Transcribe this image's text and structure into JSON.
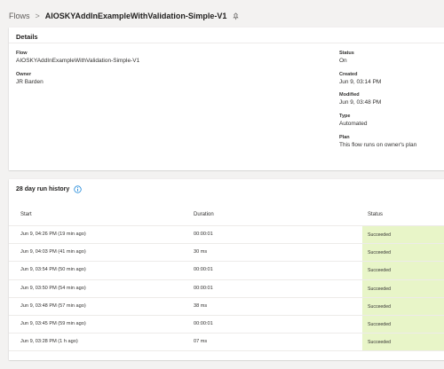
{
  "breadcrumb": {
    "root": "Flows",
    "separator": ">",
    "current": "AIOSKYAddInExampleWithValidation-Simple-V1",
    "pin_icon": "pin-icon"
  },
  "details": {
    "title": "Details",
    "flow_label": "Flow",
    "flow_value": "AIOSKYAddInExampleWithValidation-Simple-V1",
    "owner_label": "Owner",
    "owner_value": "JR Barden",
    "status_label": "Status",
    "status_value": "On",
    "created_label": "Created",
    "created_value": "Jun 9, 03:14 PM",
    "modified_label": "Modified",
    "modified_value": "Jun 9, 03:48 PM",
    "type_label": "Type",
    "type_value": "Automated",
    "plan_label": "Plan",
    "plan_value": "This flow runs on owner's plan"
  },
  "runs": {
    "title": "28 day run history",
    "info_icon": "info-icon",
    "columns": {
      "start": "Start",
      "duration": "Duration",
      "status": "Status"
    },
    "status_color": "#e8f5c8",
    "rows": [
      {
        "start": "Jun 9, 04:26 PM (19 min ago)",
        "duration": "00:00:01",
        "status": "Succeeded"
      },
      {
        "start": "Jun 9, 04:03 PM (41 min ago)",
        "duration": "30 ms",
        "status": "Succeeded"
      },
      {
        "start": "Jun 9, 03:54 PM (50 min ago)",
        "duration": "00:00:01",
        "status": "Succeeded"
      },
      {
        "start": "Jun 9, 03:50 PM (54 min ago)",
        "duration": "00:00:01",
        "status": "Succeeded"
      },
      {
        "start": "Jun 9, 03:48 PM (57 min ago)",
        "duration": "38 ms",
        "status": "Succeeded"
      },
      {
        "start": "Jun 9, 03:45 PM (59 min ago)",
        "duration": "00:00:01",
        "status": "Succeeded"
      },
      {
        "start": "Jun 9, 03:28 PM (1 h ago)",
        "duration": "07 ms",
        "status": "Succeeded"
      }
    ]
  }
}
